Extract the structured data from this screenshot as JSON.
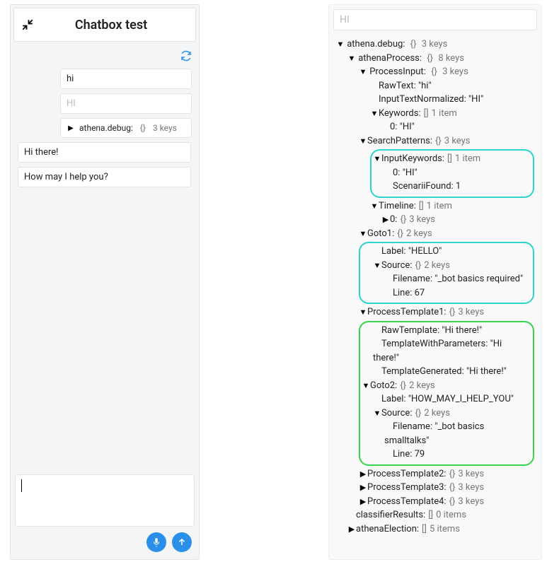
{
  "chat": {
    "title": "Chatbox test",
    "user_msg": "hi",
    "user_msg_placeholder": "HI",
    "debug_summary_key": "athena.debug:",
    "debug_summary_meta": "3 keys",
    "reply1": "Hi there!",
    "reply2": "How may I help you?",
    "input_value": ""
  },
  "right": {
    "input_placeholder": "HI"
  },
  "braces": {
    "obj": "{}",
    "arr": "[]"
  },
  "tri": {
    "down": "▼",
    "right": "▶"
  },
  "t": {
    "root_key": "athena.debug:",
    "root_meta": "3 keys",
    "ap_key": "athenaProcess:",
    "ap_meta": "8 keys",
    "pi_key": "ProcessInput:",
    "pi_meta": "3 keys",
    "raw_key": "RawText:",
    "raw_val": "\"hi\"",
    "itn_key": "InputTextNormalized:",
    "itn_val": "\"HI\"",
    "kw_key": "Keywords:",
    "kw_meta": "1 item",
    "kw0_key": "0:",
    "kw0_val": "\"HI\"",
    "sp_key": "SearchPatterns:",
    "sp_meta": "3 keys",
    "ik_key": "InputKeywords:",
    "ik_meta": "1 item",
    "ik0_key": "0:",
    "ik0_val": "\"HI\"",
    "sf_key": "ScenariiFound:",
    "sf_val": "1",
    "tl_key": "Timeline:",
    "tl_meta": "1 item",
    "tl0_key": "0:",
    "tl0_meta": "3 keys",
    "g1_key": "Goto1:",
    "g1_meta": "2 keys",
    "g1_label_key": "Label:",
    "g1_label_val": "\"HELLO\"",
    "g1_src_key": "Source:",
    "g1_src_meta": "2 keys",
    "g1_fn_key": "Filename:",
    "g1_fn_val": "\"_bot basics required\"",
    "g1_ln_key": "Line:",
    "g1_ln_val": "67",
    "pt1_key": "ProcessTemplate1:",
    "pt1_meta": "3 keys",
    "pt1_raw_key": "RawTemplate:",
    "pt1_raw_val": "\"Hi there!\"",
    "pt1_twp_key": "TemplateWithParameters:",
    "pt1_twp_val": "\"Hi there!\"",
    "pt1_tg_key": "TemplateGenerated:",
    "pt1_tg_val": "\"Hi there!\"",
    "g2_key": "Goto2:",
    "g2_meta": "2 keys",
    "g2_label_key": "Label:",
    "g2_label_val": "\"HOW_MAY_I_HELP_YOU\"",
    "g2_src_key": "Source:",
    "g2_src_meta": "2 keys",
    "g2_fn_key": "Filename:",
    "g2_fn_val": "\"_bot basics smalltalks\"",
    "g2_ln_key": "Line:",
    "g2_ln_val": "79",
    "pt2_key": "ProcessTemplate2:",
    "pt2_meta": "3 keys",
    "pt3_key": "ProcessTemplate3:",
    "pt3_meta": "3 keys",
    "pt4_key": "ProcessTemplate4:",
    "pt4_meta": "3 keys",
    "cr_key": "classifierResults:",
    "cr_meta": "0 items",
    "ae_key": "athenaElection:",
    "ae_meta": "5 items"
  }
}
